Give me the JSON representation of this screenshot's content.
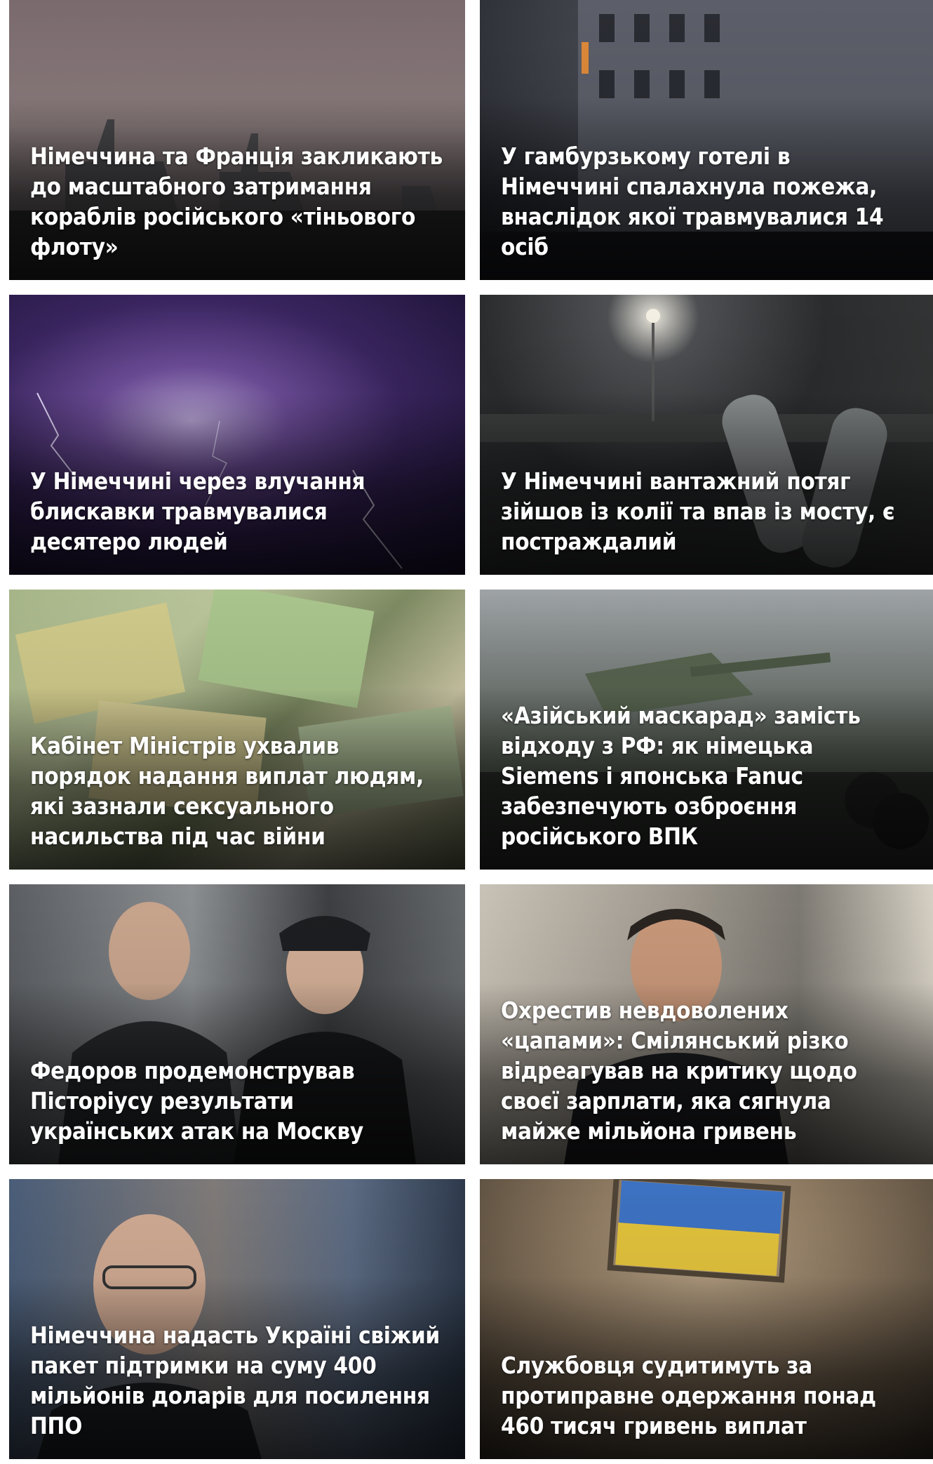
{
  "articles": [
    {
      "title": "Німеччина та Франція закликають до масштабного затримання кораблів російського «тіньового флоту»"
    },
    {
      "title": "У гамбурзькому готелі в Німеччині спалахнула пожежа, внаслідок якої травмувалися 14 осіб"
    },
    {
      "title": "У Німеччині через влучання блискавки травмувалися десятеро людей"
    },
    {
      "title": "У Німеччині вантажний потяг зійшов із колії та впав із мосту, є постраждалий"
    },
    {
      "title": "Кабінет Міністрів ухвалив порядок надання виплат людям, які зазнали сексуального насильства під час війни"
    },
    {
      "title": "«Азійський маскарад» замість відходу з РФ: як німецька Siemens і японська Fanuc забезпечують озброєння російського ВПК"
    },
    {
      "title": "Федоров продемонстрував Пісторіусу результати українських атак на Москву"
    },
    {
      "title": "Охрестив невдоволених «цапами»: Смілянський різко відреагував на критику щодо своєї зарплати, яка сягнула майже мільйона гривень"
    },
    {
      "title": "Німеччина надасть Україні свіжий пакет підтримки на суму 400 мільйонів доларів для посилення ППО"
    },
    {
      "title": "Службовця судитимуть за протиправне одержання понад 460 тисяч гривень виплат"
    }
  ]
}
